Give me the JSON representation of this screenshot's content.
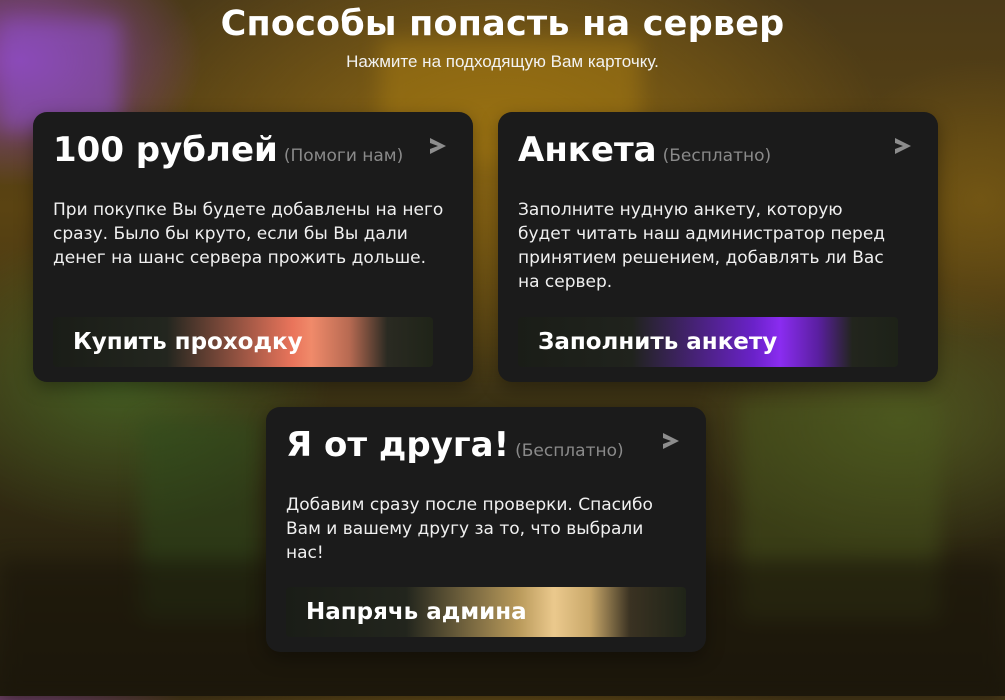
{
  "header": {
    "title": "Способы попасть на сервер",
    "subtitle": "Нажмите на подходящую Вам карточку."
  },
  "cards": [
    {
      "title": "100 рублей",
      "note": "(Помоги нам)",
      "description": "При покупке Вы будете добавлены на него сразу. Было бы круто, если бы Вы дали денег на шанс сервера прожить дольше.",
      "button": "Купить проходку",
      "icon": "chevron-right-icon",
      "accent": "#f08a6a"
    },
    {
      "title": "Анкета",
      "note": "(Бесплатно)",
      "description": "Заполните нудную анкету, которую будет читать наш администратор перед принятием решением, добавлять ли Вас на сервер.",
      "button": "Заполнить анкету",
      "icon": "chevron-right-icon",
      "accent": "#8a2cf0"
    },
    {
      "title": "Я от друга!",
      "note": "(Бесплатно)",
      "description": "Добавим сразу после проверки. Спасибо Вам и вашему другу за то, что выбрали нас!",
      "button": "Напрячь админа",
      "icon": "chevron-right-icon",
      "accent": "#ebc98d"
    }
  ]
}
